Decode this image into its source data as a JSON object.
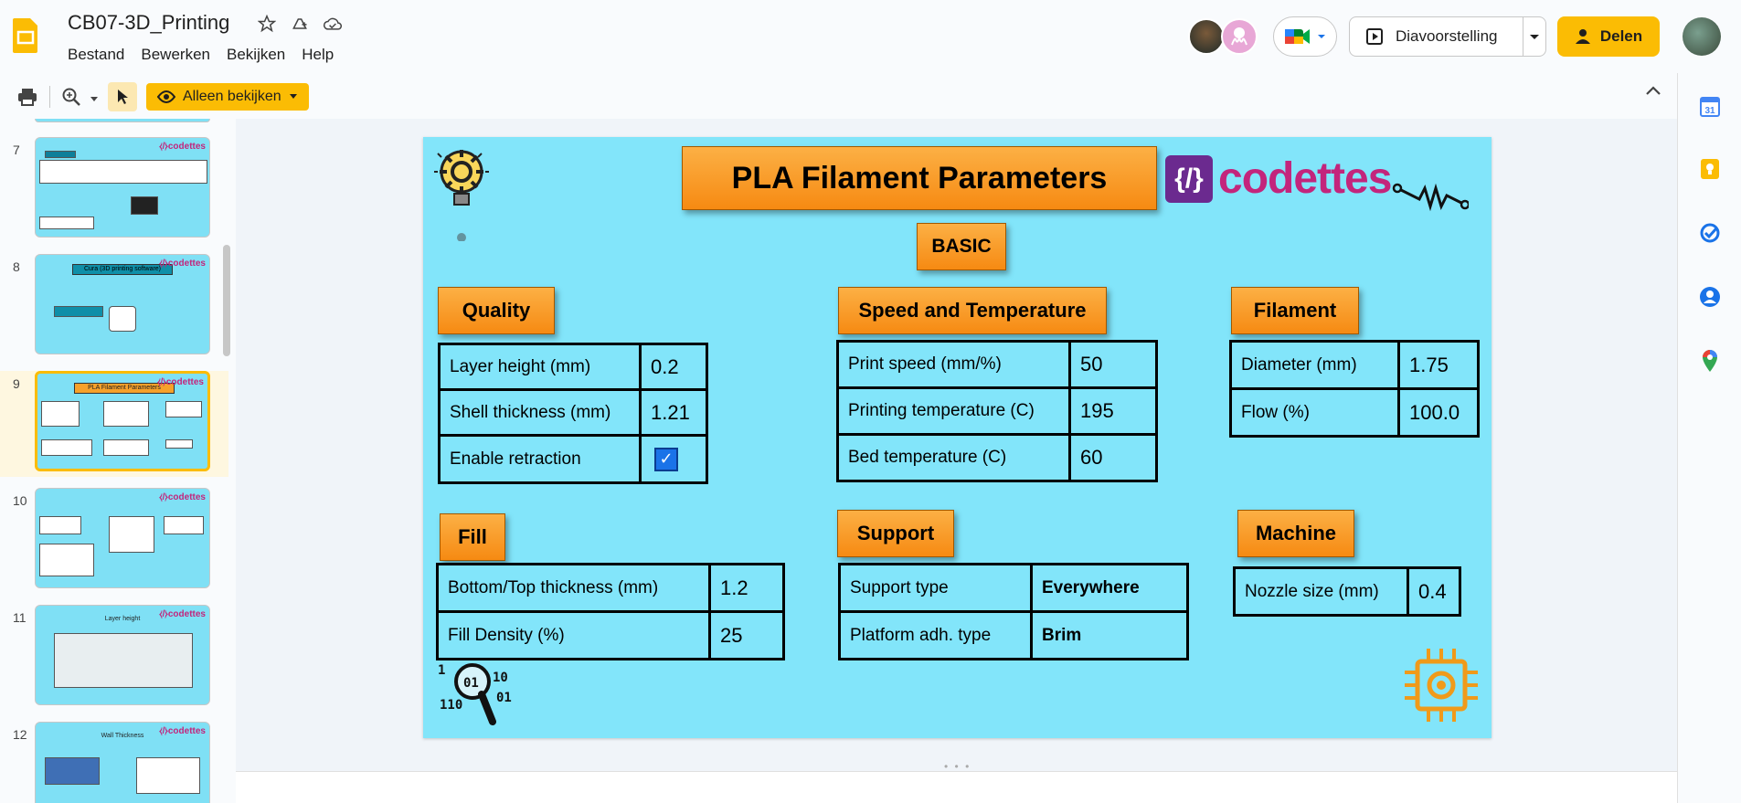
{
  "app": {
    "doc_title": "CB07-3D_Printing",
    "menu": [
      "Bestand",
      "Bewerken",
      "Bekijken",
      "Help"
    ],
    "present_label": "Diavoorstelling",
    "share_label": "Delen",
    "view_mode_label": "Alleen bekijken"
  },
  "colors": {
    "accent": "#fbbc04",
    "slide_bg": "#82e5fa",
    "badge_orange": "#f68a12",
    "brand_magenta": "#c3257c"
  },
  "filmstrip": {
    "slides": [
      {
        "num": "7"
      },
      {
        "num": "8",
        "title": "Cura (3D printing software)"
      },
      {
        "num": "9",
        "title": "PLA Filament Parameters"
      },
      {
        "num": "10"
      },
      {
        "num": "11",
        "title": "Layer height"
      },
      {
        "num": "12",
        "title": "Wall Thickness"
      }
    ],
    "active_index": 2
  },
  "slide": {
    "title": "PLA Filament Parameters",
    "basic_label": "BASIC",
    "brand": "codettes",
    "quality": {
      "heading": "Quality",
      "rows": [
        {
          "label": "Layer height (mm)",
          "value": "0.2"
        },
        {
          "label": "Shell thickness (mm)",
          "value": "1.21"
        },
        {
          "label": "Enable retraction",
          "value": ""
        }
      ]
    },
    "speed": {
      "heading": "Speed and Temperature",
      "rows": [
        {
          "label": "Print speed  (mm/%)",
          "value": "50"
        },
        {
          "label": "Printing temperature  (C)",
          "value": "195"
        },
        {
          "label": "Bed temperature (C)",
          "value": "60"
        }
      ]
    },
    "filament": {
      "heading": "Filament",
      "rows": [
        {
          "label": "Diameter (mm)",
          "value": "1.75"
        },
        {
          "label": "Flow (%)",
          "value": "100.0"
        }
      ]
    },
    "fill": {
      "heading": "Fill",
      "rows": [
        {
          "label": "Bottom/Top thickness (mm)",
          "value": "1.2"
        },
        {
          "label": "Fill Density (%)",
          "value": "25"
        }
      ]
    },
    "support": {
      "heading": "Support",
      "rows": [
        {
          "label": "Support type",
          "value": "Everywhere"
        },
        {
          "label": "Platform adh. type",
          "value": "Brim"
        }
      ]
    },
    "machine": {
      "heading": "Machine",
      "rows": [
        {
          "label": "Nozzle size (mm)",
          "value": "0.4"
        }
      ]
    }
  }
}
